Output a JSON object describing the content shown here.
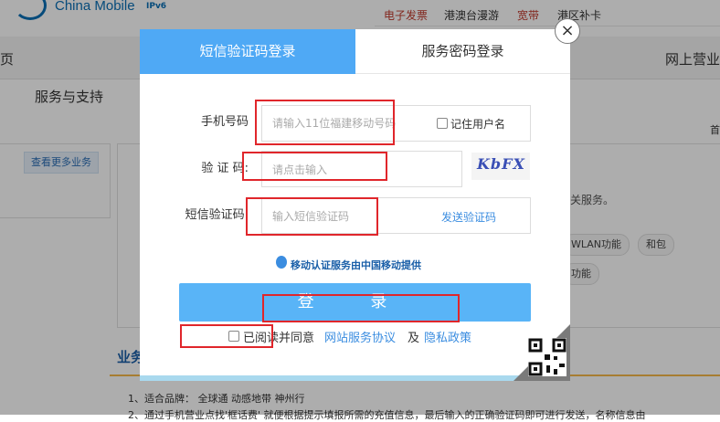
{
  "background": {
    "logo_text": "China Mobile",
    "logo_ipv6": "IPv6",
    "top_links": [
      "电子发票",
      "港澳台漫游",
      "宽带",
      "港区补卡"
    ],
    "nav_left": "页",
    "nav_right": "网上营业",
    "subnav": "服务与支持",
    "subnav_right": "首",
    "more_btn": "查看更多业务",
    "panel_text": "关服务。",
    "pills": [
      "WLAN功能",
      "和包",
      "功能"
    ],
    "section_title": "业务",
    "bottom_lines": [
      "1、适合品牌： 全球通 动感地带 神州行",
      "2、通过手机营业点找'框话费' 就便根据提示填报所需的充值信息，最后输入的正确验证码即可进行发送，名称信息由"
    ]
  },
  "modal": {
    "tabs": [
      {
        "label": "短信验证码登录",
        "active": true
      },
      {
        "label": "服务密码登录",
        "active": false
      }
    ],
    "close_label": "×",
    "phone": {
      "label": "手机号码",
      "placeholder": "请输入11位福建移动号码",
      "remember_label": "记住用户名"
    },
    "captcha": {
      "label": "验 证 码:",
      "placeholder": "请点击输入",
      "image_text": "KbFX"
    },
    "sms": {
      "label": "短信验证码:",
      "placeholder": "输入短信验证码",
      "send_label": "发送验证码"
    },
    "notice": "移动认证服务由中国移动提供",
    "login_label": "登 录",
    "agree": {
      "prefix": "已阅读并同意",
      "link1": "网站服务协议",
      "and": "及",
      "link2": "隐私政策"
    }
  },
  "colors": {
    "accent": "#4fa9f5",
    "button": "#59b4f7",
    "link": "#3b8de0",
    "annotation": "#e0262b"
  }
}
